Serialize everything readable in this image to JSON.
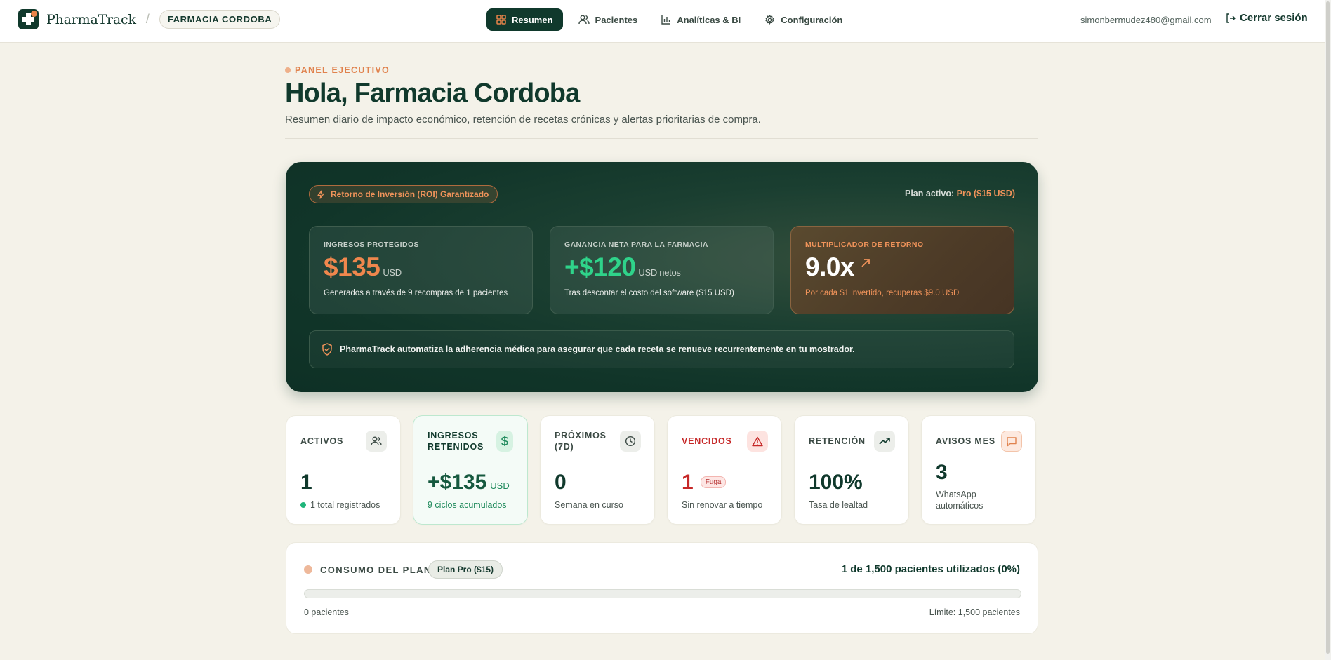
{
  "header": {
    "brand": "PharmaTrack",
    "separator": "/",
    "organization": "FARMACIA CORDOBA",
    "nav": [
      {
        "label": "Resumen",
        "icon": "grid-icon",
        "active": true
      },
      {
        "label": "Pacientes",
        "icon": "users-icon",
        "active": false
      },
      {
        "label": "Analíticas & BI",
        "icon": "bar-chart-icon",
        "active": false
      },
      {
        "label": "Configuración",
        "icon": "gear-icon",
        "active": false
      }
    ],
    "user_email": "simonbermudez480@gmail.com",
    "logout_label": "Cerrar sesión"
  },
  "intro": {
    "eyebrow": "PANEL EJECUTIVO",
    "title": "Hola, Farmacia Cordoba",
    "subtitle": "Resumen diario de impacto económico, retención de recetas crónicas y alertas prioritarias de compra."
  },
  "hero": {
    "roi_label": "Retorno de Inversión (ROI) Garantizado",
    "plan_prefix": "Plan activo:",
    "plan_value": "Pro ($15 USD)",
    "kpis": [
      {
        "label": "INGRESOS PROTEGIDOS",
        "value": "$135",
        "unit": "USD",
        "note": "Generados a través de 9 recompras de 1 pacientes",
        "color": "#f0874d"
      },
      {
        "label": "GANANCIA NETA PARA LA FARMACIA",
        "value": "+$120",
        "unit": "USD netos",
        "note": "Tras descontar el costo del software ($15 USD)",
        "color": "#2fd38a"
      },
      {
        "label": "MULTIPLICADOR DE RETORNO",
        "value": "9.0x",
        "unit": "",
        "note": "Por cada $1 invertido, recuperas $9.0 USD",
        "color": "#ffffff"
      }
    ],
    "info": "PharmaTrack automatiza la adherencia médica para asegurar que cada receta se renueve recurrentemente en tu mostrador."
  },
  "stats": [
    {
      "label": "ACTIVOS",
      "value": "1",
      "unit": "",
      "sub": "1 total registrados",
      "icon": "users-icon"
    },
    {
      "label_line1": "INGRESOS",
      "label_line2": "RETENIDOS",
      "value": "+$135",
      "unit": "USD",
      "sub": "9 ciclos acumulados",
      "icon": "dollar-icon"
    },
    {
      "label_line1": "PRÓXIMOS",
      "label_line2": "(7D)",
      "value": "0",
      "unit": "",
      "sub": "Semana en curso",
      "icon": "clock-icon"
    },
    {
      "label": "VENCIDOS",
      "value": "1",
      "badge": "Fuga",
      "sub": "Sin renovar a tiempo",
      "icon": "alert-triangle-icon"
    },
    {
      "label": "RETENCIÓN",
      "value": "100%",
      "unit": "",
      "sub": "Tasa de lealtad",
      "icon": "trending-up-icon"
    },
    {
      "label": "AVISOS MES",
      "value": "3",
      "unit": "",
      "sub_line1": "WhatsApp",
      "sub_line2": "automáticos",
      "icon": "message-icon"
    }
  ],
  "usage": {
    "title": "CONSUMO DEL PLAN",
    "plan_badge": "Plan Pro ($15)",
    "count_text": "1 de 1,500 pacientes utilizados (0%)",
    "progress_percent": 0,
    "min_label": "0 pacientes",
    "max_label": "Límite: 1,500 pacientes"
  },
  "colors": {
    "brand_dark": "#10392c",
    "accent_orange": "#f0874d",
    "accent_green": "#2fd38a",
    "alert_red": "#c62828",
    "page_bg": "#f4f2e9"
  }
}
